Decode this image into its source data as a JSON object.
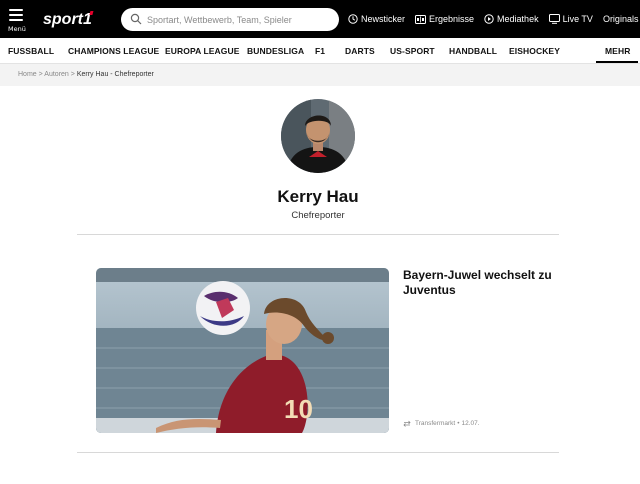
{
  "header": {
    "menu_label": "Menü",
    "logo_text": "sport1",
    "search_placeholder": "Sportart, Wettbewerb, Team, Spieler",
    "links": [
      {
        "label": "Newsticker",
        "icon": "clock-icon"
      },
      {
        "label": "Ergebnisse",
        "icon": "scoreboard-icon"
      },
      {
        "label": "Mediathek",
        "icon": "play-circle-icon"
      },
      {
        "label": "Live TV",
        "icon": "tv-icon"
      },
      {
        "label": "Originals",
        "icon": "chevron-down-icon"
      }
    ]
  },
  "sport_nav": {
    "items": [
      "FUSSBALL",
      "CHAMPIONS LEAGUE",
      "EUROPA LEAGUE",
      "BUNDESLIGA",
      "F1",
      "DARTS",
      "US-SPORT",
      "HANDBALL",
      "EISHOCKEY"
    ],
    "more_label": "MEHR"
  },
  "breadcrumb": {
    "home": "Home",
    "separator": ">",
    "section": "Autoren",
    "current": "Kerry Hau - Chefreporter"
  },
  "author": {
    "name": "Kerry Hau",
    "role": "Chefreporter"
  },
  "article": {
    "title": "Bayern-Juwel wechselt zu Juventus",
    "category": "Transfermarkt",
    "meta_separator": "•",
    "date": "12.07."
  },
  "colors": {
    "header_bg": "#000000",
    "accent": "#e4002b",
    "breadcrumb_bg": "#f3f3f3"
  }
}
